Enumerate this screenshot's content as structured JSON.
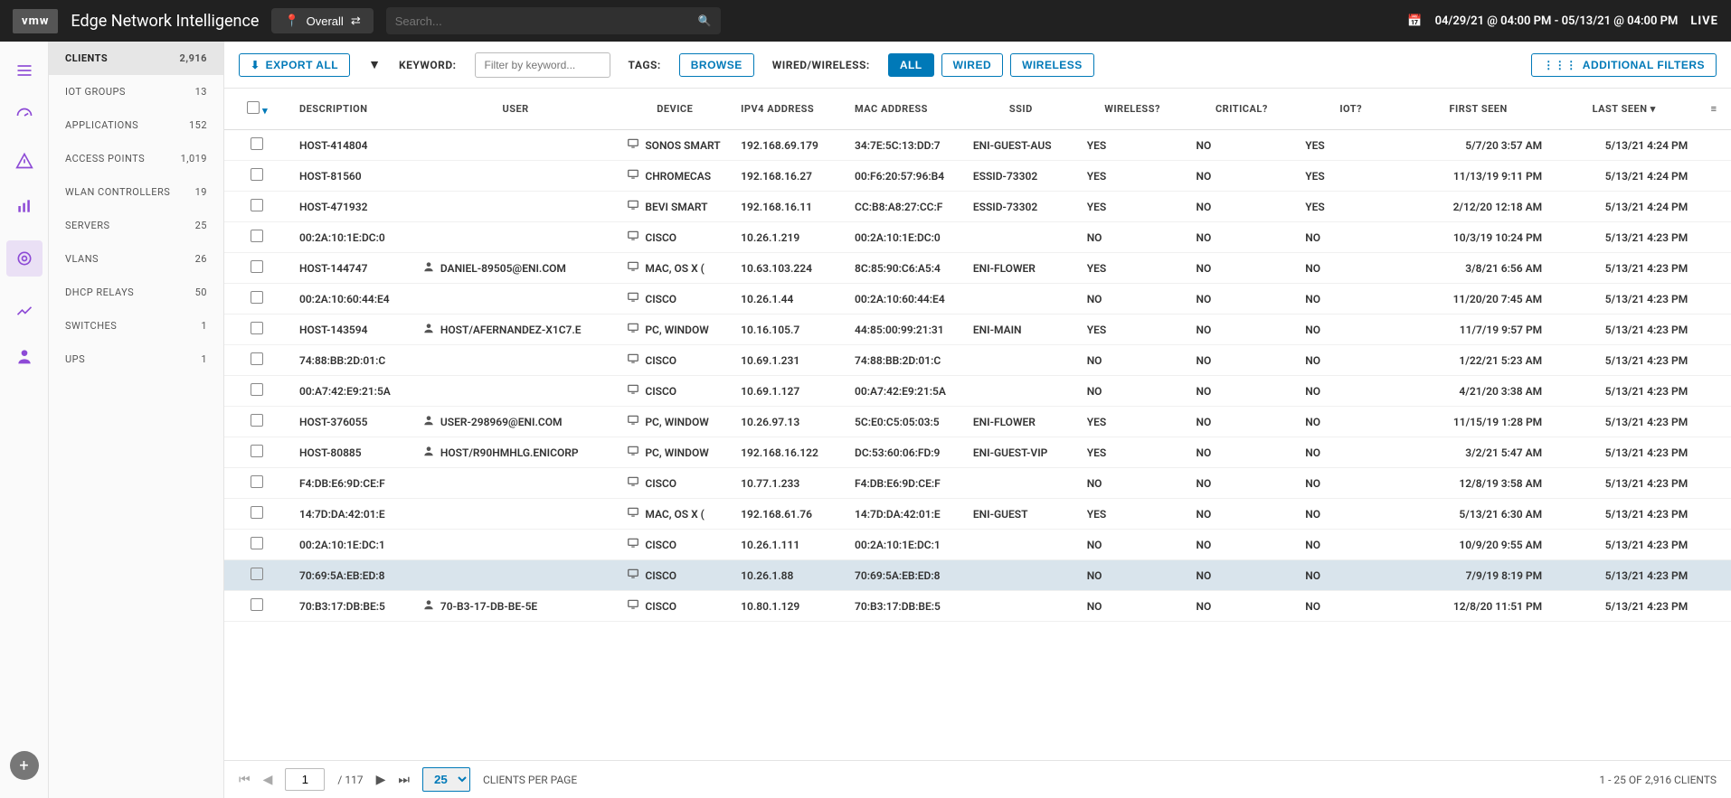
{
  "header": {
    "logo": "vmw",
    "product": "Edge Network Intelligence",
    "scope_label": "Overall",
    "search_placeholder": "Search...",
    "date_range": "04/29/21 @ 04:00 PM - 05/13/21 @ 04:00 PM",
    "live_label": "LIVE"
  },
  "sidebar": {
    "items": [
      {
        "label": "CLIENTS",
        "count": "2,916",
        "selected": true
      },
      {
        "label": "IOT GROUPS",
        "count": "13"
      },
      {
        "label": "APPLICATIONS",
        "count": "152"
      },
      {
        "label": "ACCESS POINTS",
        "count": "1,019"
      },
      {
        "label": "WLAN CONTROLLERS",
        "count": "19"
      },
      {
        "label": "SERVERS",
        "count": "25"
      },
      {
        "label": "VLANS",
        "count": "26"
      },
      {
        "label": "DHCP RELAYS",
        "count": "50"
      },
      {
        "label": "SWITCHES",
        "count": "1"
      },
      {
        "label": "UPS",
        "count": "1"
      }
    ]
  },
  "toolbar": {
    "export_label": "EXPORT ALL",
    "keyword_label": "KEYWORD:",
    "keyword_placeholder": "Filter by keyword...",
    "tags_label": "TAGS:",
    "browse_label": "BROWSE",
    "ww_label": "WIRED/WIRELESS:",
    "ww_all": "ALL",
    "ww_wired": "WIRED",
    "ww_wireless": "WIRELESS",
    "additional_filters": "ADDITIONAL FILTERS"
  },
  "table": {
    "headers": {
      "description": "DESCRIPTION",
      "user": "USER",
      "device": "DEVICE",
      "ipv4": "IPV4 ADDRESS",
      "mac": "MAC ADDRESS",
      "ssid": "SSID",
      "wireless": "WIRELESS?",
      "critical": "CRITICAL?",
      "iot": "IOT?",
      "first_seen": "FIRST SEEN",
      "last_seen": "LAST SEEN"
    },
    "rows": [
      {
        "desc": "HOST-414804",
        "user": "",
        "device": "SONOS SMART",
        "ip": "192.168.69.179",
        "mac": "34:7E:5C:13:DD:7",
        "ssid": "ENI-GUEST-AUS",
        "wl": "YES",
        "crit": "NO",
        "iot": "YES",
        "first": "5/7/20 3:57 AM",
        "last": "5/13/21 4:24 PM"
      },
      {
        "desc": "HOST-81560",
        "user": "",
        "device": "CHROMECAS",
        "ip": "192.168.16.27",
        "mac": "00:F6:20:57:96:B4",
        "ssid": "ESSID-73302",
        "wl": "YES",
        "crit": "NO",
        "iot": "YES",
        "first": "11/13/19 9:11 PM",
        "last": "5/13/21 4:24 PM"
      },
      {
        "desc": "HOST-471932",
        "user": "",
        "device": "BEVI SMART",
        "ip": "192.168.16.11",
        "mac": "CC:B8:A8:27:CC:F",
        "ssid": "ESSID-73302",
        "wl": "YES",
        "crit": "NO",
        "iot": "YES",
        "first": "2/12/20 12:18 AM",
        "last": "5/13/21 4:24 PM"
      },
      {
        "desc": "00:2A:10:1E:DC:0",
        "user": "",
        "device": "CISCO",
        "ip": "10.26.1.219",
        "mac": "00:2A:10:1E:DC:0",
        "ssid": "",
        "wl": "NO",
        "crit": "NO",
        "iot": "NO",
        "first": "10/3/19 10:24 PM",
        "last": "5/13/21 4:23 PM"
      },
      {
        "desc": "HOST-144747",
        "user": "DANIEL-89505@ENI.COM",
        "device": "MAC, OS X (",
        "ip": "10.63.103.224",
        "mac": "8C:85:90:C6:A5:4",
        "ssid": "ENI-FLOWER",
        "wl": "YES",
        "crit": "NO",
        "iot": "NO",
        "first": "3/8/21 6:56 AM",
        "last": "5/13/21 4:23 PM"
      },
      {
        "desc": "00:2A:10:60:44:E4",
        "user": "",
        "device": "CISCO",
        "ip": "10.26.1.44",
        "mac": "00:2A:10:60:44:E4",
        "ssid": "",
        "wl": "NO",
        "crit": "NO",
        "iot": "NO",
        "first": "11/20/20 7:45 AM",
        "last": "5/13/21 4:23 PM"
      },
      {
        "desc": "HOST-143594",
        "user": "HOST/AFERNANDEZ-X1C7.E",
        "device": "PC, WINDOW",
        "ip": "10.16.105.7",
        "mac": "44:85:00:99:21:31",
        "ssid": "ENI-MAIN",
        "wl": "YES",
        "crit": "NO",
        "iot": "NO",
        "first": "11/7/19 9:57 PM",
        "last": "5/13/21 4:23 PM"
      },
      {
        "desc": "74:88:BB:2D:01:C",
        "user": "",
        "device": "CISCO",
        "ip": "10.69.1.231",
        "mac": "74:88:BB:2D:01:C",
        "ssid": "",
        "wl": "NO",
        "crit": "NO",
        "iot": "NO",
        "first": "1/22/21 5:23 AM",
        "last": "5/13/21 4:23 PM"
      },
      {
        "desc": "00:A7:42:E9:21:5A",
        "user": "",
        "device": "CISCO",
        "ip": "10.69.1.127",
        "mac": "00:A7:42:E9:21:5A",
        "ssid": "",
        "wl": "NO",
        "crit": "NO",
        "iot": "NO",
        "first": "4/21/20 3:38 AM",
        "last": "5/13/21 4:23 PM"
      },
      {
        "desc": "HOST-376055",
        "user": "USER-298969@ENI.COM",
        "device": "PC, WINDOW",
        "ip": "10.26.97.13",
        "mac": "5C:E0:C5:05:03:5",
        "ssid": "ENI-FLOWER",
        "wl": "YES",
        "crit": "NO",
        "iot": "NO",
        "first": "11/15/19 1:28 PM",
        "last": "5/13/21 4:23 PM"
      },
      {
        "desc": "HOST-80885",
        "user": "HOST/R90HMHLG.ENICORP",
        "device": "PC, WINDOW",
        "ip": "192.168.16.122",
        "mac": "DC:53:60:06:FD:9",
        "ssid": "ENI-GUEST-VIP",
        "wl": "YES",
        "crit": "NO",
        "iot": "NO",
        "first": "3/2/21 5:47 AM",
        "last": "5/13/21 4:23 PM"
      },
      {
        "desc": "F4:DB:E6:9D:CE:F",
        "user": "",
        "device": "CISCO",
        "ip": "10.77.1.233",
        "mac": "F4:DB:E6:9D:CE:F",
        "ssid": "",
        "wl": "NO",
        "crit": "NO",
        "iot": "NO",
        "first": "12/8/19 3:58 AM",
        "last": "5/13/21 4:23 PM"
      },
      {
        "desc": "14:7D:DA:42:01:E",
        "user": "",
        "device": "MAC, OS X (",
        "ip": "192.168.61.76",
        "mac": "14:7D:DA:42:01:E",
        "ssid": "ENI-GUEST",
        "wl": "YES",
        "crit": "NO",
        "iot": "NO",
        "first": "5/13/21 6:30 AM",
        "last": "5/13/21 4:23 PM"
      },
      {
        "desc": "00:2A:10:1E:DC:1",
        "user": "",
        "device": "CISCO",
        "ip": "10.26.1.111",
        "mac": "00:2A:10:1E:DC:1",
        "ssid": "",
        "wl": "NO",
        "crit": "NO",
        "iot": "NO",
        "first": "10/9/20 9:55 AM",
        "last": "5/13/21 4:23 PM"
      },
      {
        "desc": "70:69:5A:EB:ED:8",
        "user": "",
        "device": "CISCO",
        "ip": "10.26.1.88",
        "mac": "70:69:5A:EB:ED:8",
        "ssid": "",
        "wl": "NO",
        "crit": "NO",
        "iot": "NO",
        "first": "7/9/19 8:19 PM",
        "last": "5/13/21 4:23 PM",
        "highlight": true
      },
      {
        "desc": "70:B3:17:DB:BE:5",
        "user": "70-B3-17-DB-BE-5E",
        "device": "CISCO",
        "ip": "10.80.1.129",
        "mac": "70:B3:17:DB:BE:5",
        "ssid": "",
        "wl": "NO",
        "crit": "NO",
        "iot": "NO",
        "first": "12/8/20 11:51 PM",
        "last": "5/13/21 4:23 PM"
      }
    ]
  },
  "pager": {
    "page": "1",
    "total_pages": "/ 117",
    "page_size": "25",
    "size_label": "CLIENTS PER PAGE",
    "summary": "1 - 25 OF 2,916 CLIENTS"
  }
}
